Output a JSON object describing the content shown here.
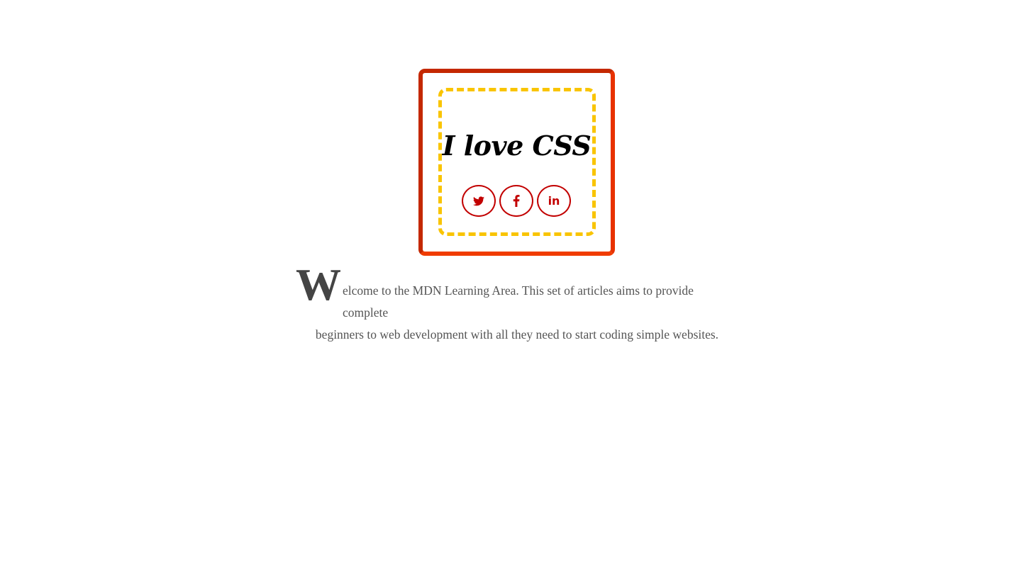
{
  "card": {
    "title": "I love CSS",
    "outer_border_color": "#d52a00",
    "inner_border_color": "#f9c400",
    "social_links": [
      {
        "name": "twitter",
        "icon": "twitter-icon"
      },
      {
        "name": "facebook",
        "icon": "facebook-icon",
        "glyph": "f"
      },
      {
        "name": "linkedin",
        "icon": "linkedin-icon",
        "glyph": "in"
      }
    ],
    "social_color": "#c20000"
  },
  "intro": {
    "dropcap": "W",
    "line1_rest": "elcome to the MDN Learning Area. This set of articles aims to provide complete",
    "line2": "beginners to web development with all they need to start coding simple websites."
  }
}
